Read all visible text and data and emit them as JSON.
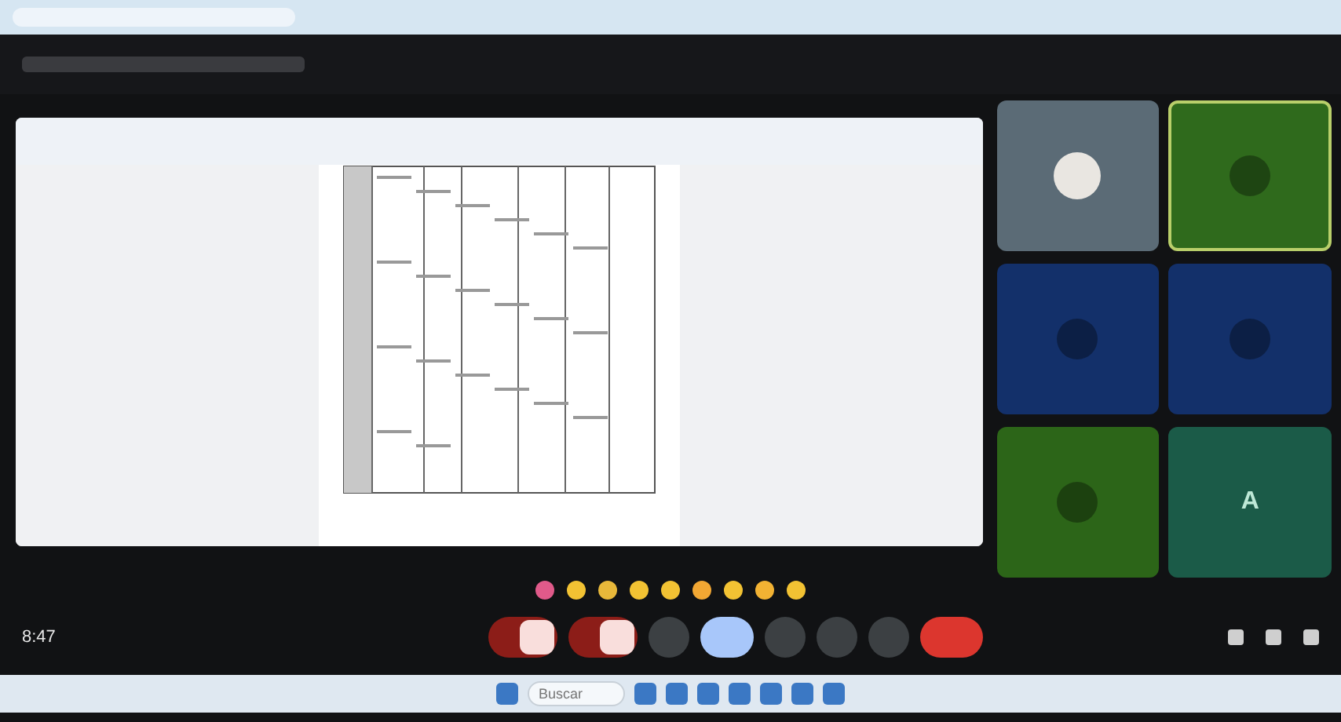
{
  "meeting": {
    "time": "8:47"
  },
  "tiles": [
    {
      "kind": "photo",
      "color": "#5b6b76",
      "speaking": false
    },
    {
      "kind": "avatar",
      "color": "#2f6a1c",
      "speaking": true
    },
    {
      "kind": "avatar",
      "color": "#13306a",
      "speaking": false
    },
    {
      "kind": "avatar",
      "color": "#13306a",
      "speaking": false
    },
    {
      "kind": "avatar",
      "color": "#2c6518",
      "speaking": false
    },
    {
      "kind": "letter",
      "letter": "A",
      "color": "#1b5b48",
      "speaking": false
    }
  ],
  "reactions": [
    {
      "color": "#e05a8a"
    },
    {
      "color": "#f2c233"
    },
    {
      "color": "#e8b83a"
    },
    {
      "color": "#f2c233"
    },
    {
      "color": "#f2c233"
    },
    {
      "color": "#f2a733"
    },
    {
      "color": "#f2c233"
    },
    {
      "color": "#f2b233"
    },
    {
      "color": "#f2c233"
    }
  ],
  "controls": [
    {
      "kind": "mic",
      "muted": true
    },
    {
      "kind": "camera",
      "muted": true
    },
    {
      "kind": "captions",
      "selected": false
    },
    {
      "kind": "emoji",
      "selected": true
    },
    {
      "kind": "present",
      "selected": false
    },
    {
      "kind": "hand",
      "selected": false
    },
    {
      "kind": "more",
      "selected": false
    },
    {
      "kind": "end"
    }
  ],
  "taskbar": {
    "search": {
      "placeholder": "Buscar"
    }
  }
}
